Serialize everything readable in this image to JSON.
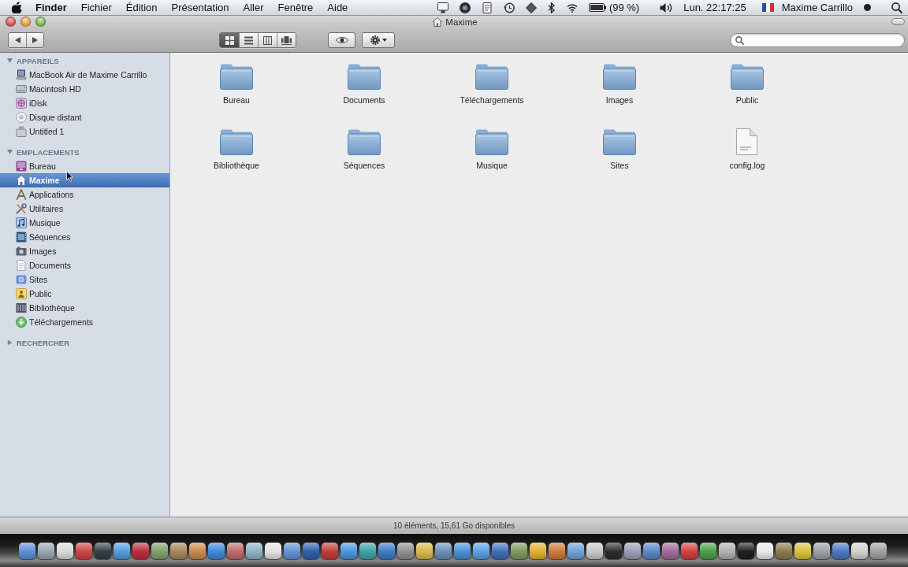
{
  "menu_bar": {
    "menus": [
      "Finder",
      "Fichier",
      "Édition",
      "Présentation",
      "Aller",
      "Fenêtre",
      "Aide"
    ],
    "battery": "(99 %)",
    "clock": "Lun. 22:17:25",
    "user": "Maxime Carrillo"
  },
  "window": {
    "title": "Maxime"
  },
  "toolbar": {
    "view_modes": [
      {
        "kind": "icons",
        "selected": true
      },
      {
        "kind": "list",
        "selected": false
      },
      {
        "kind": "columns",
        "selected": false
      },
      {
        "kind": "coverflow",
        "selected": false
      }
    ]
  },
  "sidebar": {
    "sections": [
      {
        "title": "APPAREILS",
        "expanded": true,
        "items": [
          {
            "label": "MacBook Air de Maxime Carrillo",
            "kind": "computer",
            "selected": false
          },
          {
            "label": "Macintosh HD",
            "kind": "disk",
            "selected": false
          },
          {
            "label": "iDisk",
            "kind": "network",
            "selected": false
          },
          {
            "label": "Disque distant",
            "kind": "disc",
            "selected": false
          },
          {
            "label": "Untitled 1",
            "kind": "volume",
            "selected": false
          }
        ]
      },
      {
        "title": "EMPLACEMENTS",
        "expanded": true,
        "items": [
          {
            "label": "Bureau",
            "kind": "desktop",
            "selected": false
          },
          {
            "label": "Maxime",
            "kind": "home",
            "selected": true
          },
          {
            "label": "Applications",
            "kind": "apps",
            "selected": false
          },
          {
            "label": "Utilitaires",
            "kind": "utilities",
            "selected": false
          },
          {
            "label": "Musique",
            "kind": "music",
            "selected": false
          },
          {
            "label": "Séquences",
            "kind": "movies",
            "selected": false
          },
          {
            "label": "Images",
            "kind": "pictures",
            "selected": false
          },
          {
            "label": "Documents",
            "kind": "documents",
            "selected": false
          },
          {
            "label": "Sites",
            "kind": "sites",
            "selected": false
          },
          {
            "label": "Public",
            "kind": "public",
            "selected": false
          },
          {
            "label": "Bibliothèque",
            "kind": "library",
            "selected": false
          },
          {
            "label": "Téléchargements",
            "kind": "downloads",
            "selected": false
          }
        ]
      },
      {
        "title": "RECHERCHER",
        "expanded": false
      }
    ]
  },
  "content": {
    "items": [
      {
        "name": "Bureau",
        "kind": "folder"
      },
      {
        "name": "Documents",
        "kind": "folder"
      },
      {
        "name": "Téléchargements",
        "kind": "folder"
      },
      {
        "name": "Images",
        "kind": "folder"
      },
      {
        "name": "Public",
        "kind": "folder"
      },
      {
        "name": "Bibliothèque",
        "kind": "folder"
      },
      {
        "name": "Séquences",
        "kind": "folder"
      },
      {
        "name": "Musique",
        "kind": "folder"
      },
      {
        "name": "Sites",
        "kind": "folder"
      },
      {
        "name": "config.log",
        "kind": "file"
      }
    ]
  },
  "status_bar": {
    "text": "10 éléments, 15,61 Go disponibles"
  }
}
